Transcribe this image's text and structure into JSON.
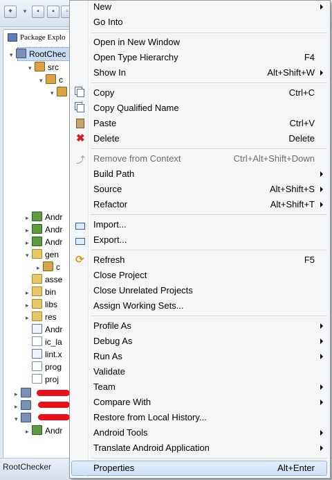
{
  "view": {
    "tab_title": "Package Explo",
    "status_text": "RootChecker"
  },
  "tree": [
    {
      "label": "RootChec",
      "icon": "project-icon",
      "twisty": "▾",
      "selected": true
    },
    {
      "label": "src",
      "icon": "source-folder-icon",
      "twisty": "▾"
    },
    {
      "label": "c",
      "icon": "package-icon",
      "twisty": "▾"
    },
    {
      "label": "",
      "icon": "package-icon",
      "twisty": "▾"
    },
    {
      "label": "Andr",
      "icon": "library-icon",
      "twisty": "▸"
    },
    {
      "label": "Andr",
      "icon": "library-icon",
      "twisty": "▸"
    },
    {
      "label": "Andr",
      "icon": "library-icon",
      "twisty": "▸"
    },
    {
      "label": "gen",
      "icon": "source-folder-icon",
      "twisty": "▾"
    },
    {
      "label": "c",
      "icon": "package-icon",
      "twisty": "▸"
    },
    {
      "label": "asse",
      "icon": "folder-icon",
      "twisty": ""
    },
    {
      "label": "bin",
      "icon": "folder-icon",
      "twisty": "▸"
    },
    {
      "label": "libs",
      "icon": "folder-icon",
      "twisty": "▸"
    },
    {
      "label": "res",
      "icon": "folder-icon",
      "twisty": "▸"
    },
    {
      "label": "Andr",
      "icon": "xml-file-icon",
      "twisty": ""
    },
    {
      "label": "ic_la",
      "icon": "file-icon",
      "twisty": ""
    },
    {
      "label": "lint.x",
      "icon": "xml-file-icon",
      "twisty": ""
    },
    {
      "label": "prog",
      "icon": "file-icon",
      "twisty": ""
    },
    {
      "label": "proj",
      "icon": "file-icon",
      "twisty": ""
    },
    {
      "label": "",
      "icon": "project-icon",
      "twisty": "▸"
    },
    {
      "label": "",
      "icon": "project-icon",
      "twisty": "▸"
    },
    {
      "label": "",
      "icon": "project-icon",
      "twisty": "▾"
    },
    {
      "label": "Andr",
      "icon": "library-icon",
      "twisty": "▸"
    }
  ],
  "menu": {
    "items": [
      {
        "label": "New",
        "shortcut": "",
        "submenu": true
      },
      {
        "label": "Go Into",
        "shortcut": "",
        "submenu": false
      },
      {
        "label": "Open in New Window",
        "shortcut": "",
        "submenu": false
      },
      {
        "label": "Open Type Hierarchy",
        "shortcut": "F4",
        "submenu": false
      },
      {
        "label": "Show In",
        "shortcut": "Alt+Shift+W",
        "submenu": true
      },
      {
        "label": "Copy",
        "shortcut": "Ctrl+C",
        "icon": "copy-icon"
      },
      {
        "label": "Copy Qualified Name",
        "shortcut": "",
        "icon": "copy-qualified-name-icon"
      },
      {
        "label": "Paste",
        "shortcut": "Ctrl+V",
        "icon": "paste-icon"
      },
      {
        "label": "Delete",
        "shortcut": "Delete",
        "icon": "delete-icon"
      },
      {
        "label": "Remove from Context",
        "shortcut": "Ctrl+Alt+Shift+Down",
        "disabled": true,
        "icon": "remove-context-icon"
      },
      {
        "label": "Build Path",
        "shortcut": "",
        "submenu": true
      },
      {
        "label": "Source",
        "shortcut": "Alt+Shift+S",
        "submenu": true
      },
      {
        "label": "Refactor",
        "shortcut": "Alt+Shift+T",
        "submenu": true
      },
      {
        "label": "Import...",
        "shortcut": "",
        "icon": "import-icon"
      },
      {
        "label": "Export...",
        "shortcut": "",
        "icon": "export-icon"
      },
      {
        "label": "Refresh",
        "shortcut": "F5",
        "icon": "refresh-icon"
      },
      {
        "label": "Close Project",
        "shortcut": ""
      },
      {
        "label": "Close Unrelated Projects",
        "shortcut": ""
      },
      {
        "label": "Assign Working Sets...",
        "shortcut": ""
      },
      {
        "label": "Profile As",
        "shortcut": "",
        "submenu": true
      },
      {
        "label": "Debug As",
        "shortcut": "",
        "submenu": true
      },
      {
        "label": "Run As",
        "shortcut": "",
        "submenu": true
      },
      {
        "label": "Validate",
        "shortcut": ""
      },
      {
        "label": "Team",
        "shortcut": "",
        "submenu": true
      },
      {
        "label": "Compare With",
        "shortcut": "",
        "submenu": true
      },
      {
        "label": "Restore from Local History...",
        "shortcut": ""
      },
      {
        "label": "Android Tools",
        "shortcut": "",
        "submenu": true
      },
      {
        "label": "Translate Android Application",
        "shortcut": "",
        "submenu": true
      },
      {
        "label": "Properties",
        "shortcut": "Alt+Enter",
        "highlighted": true
      }
    ]
  }
}
